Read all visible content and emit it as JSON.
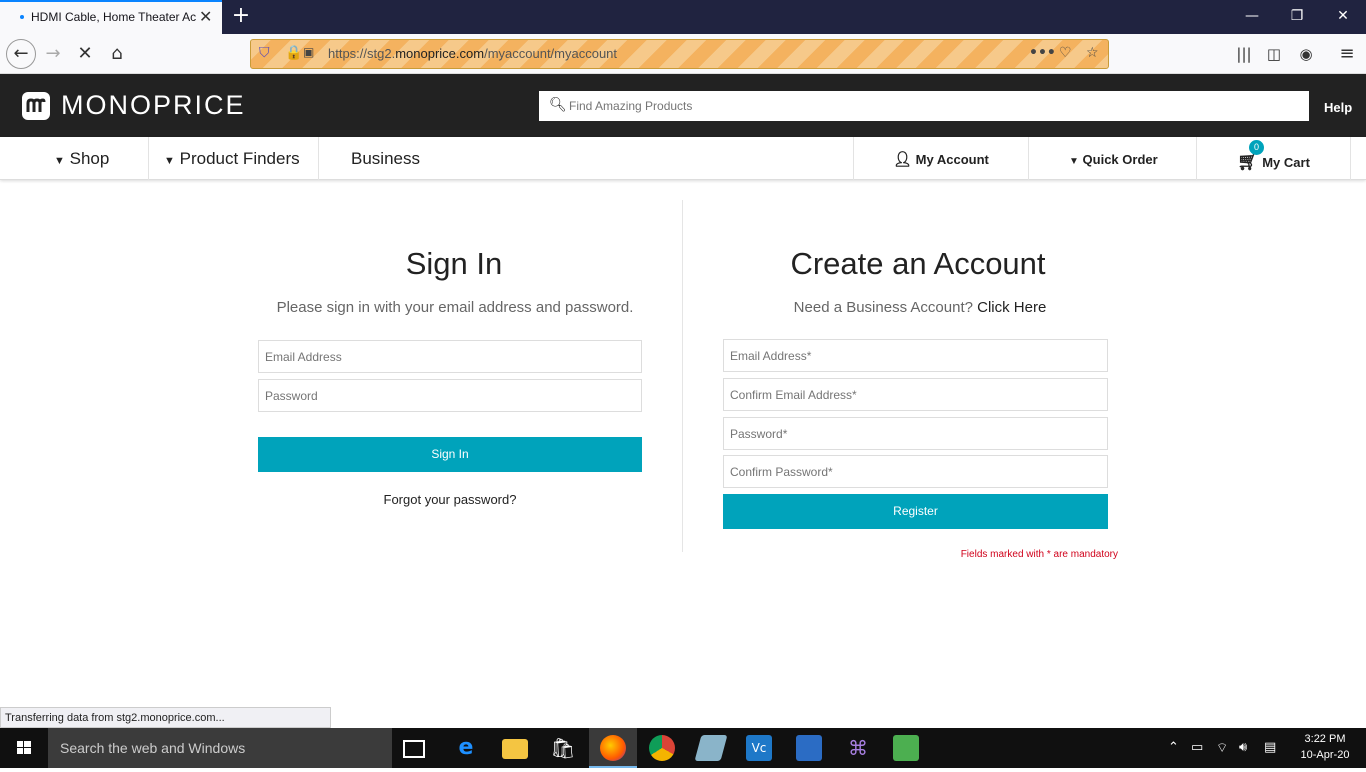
{
  "browser": {
    "tab_title": "HDMI Cable, Home Theater Ac",
    "url_prefix": "https://stg2.",
    "url_domain": "monoprice.com",
    "url_path": "/myaccount/myaccount",
    "status_text": "Transferring data from stg2.monoprice.com..."
  },
  "site": {
    "logo_text": "MONOPRICE",
    "search_placeholder": "Find Amazing Products",
    "help_label": "Help",
    "nav": {
      "shop": "Shop",
      "product_finders": "Product Finders",
      "business": "Business",
      "my_account": "My Account",
      "quick_order": "Quick Order",
      "my_cart": "My Cart",
      "cart_count": "0"
    }
  },
  "signin": {
    "title": "Sign In",
    "subtitle": "Please sign in with your email address and password.",
    "email_placeholder": "Email Address",
    "password_placeholder": "Password",
    "button": "Sign In",
    "forgot": "Forgot your password?"
  },
  "register": {
    "title": "Create an Account",
    "subtitle_text": "Need a Business Account? ",
    "subtitle_link": "Click Here",
    "email_placeholder": "Email Address*",
    "confirm_email_placeholder": "Confirm Email Address*",
    "password_placeholder": "Password*",
    "confirm_password_placeholder": "Confirm Password*",
    "button": "Register",
    "mandatory_note": "Fields marked with * are mandatory"
  },
  "taskbar": {
    "search_text": "Search the web and Windows",
    "time": "3:22 PM",
    "date": "10-Apr-20"
  },
  "colors": {
    "accent": "#00a3bb",
    "header_bg": "#222222",
    "error": "#d0021b"
  }
}
